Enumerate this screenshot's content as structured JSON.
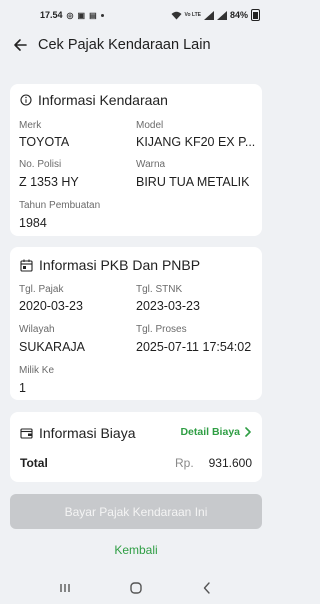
{
  "status_bar": {
    "time": "17.54",
    "battery": "84%",
    "network": "Vo LTE"
  },
  "header": {
    "title": "Cek Pajak Kendaraan Lain"
  },
  "vehicle_info": {
    "title": "Informasi Kendaraan",
    "fields": {
      "merk": {
        "label": "Merk",
        "value": "TOYOTA"
      },
      "model": {
        "label": "Model",
        "value": "KIJANG KF20 EX P..."
      },
      "no_polisi": {
        "label": "No. Polisi",
        "value": "Z 1353 HY"
      },
      "warna": {
        "label": "Warna",
        "value": "BIRU TUA METALIK"
      },
      "tahun": {
        "label": "Tahun Pembuatan",
        "value": "1984"
      }
    }
  },
  "pkb_info": {
    "title": "Informasi PKB Dan PNBP",
    "fields": {
      "tgl_pajak": {
        "label": "Tgl. Pajak",
        "value": "2020-03-23"
      },
      "tgl_stnk": {
        "label": "Tgl. STNK",
        "value": "2023-03-23"
      },
      "wilayah": {
        "label": "Wilayah",
        "value": "SUKARAJA"
      },
      "tgl_proses": {
        "label": "Tgl. Proses",
        "value": "2025-07-11 17:54:02"
      },
      "milik_ke": {
        "label": "Milik Ke",
        "value": "1"
      }
    }
  },
  "cost_info": {
    "title": "Informasi Biaya",
    "detail_label": "Detail Biaya",
    "total_label": "Total",
    "currency": "Rp.",
    "amount": "931.600"
  },
  "actions": {
    "pay_label": "Bayar Pajak Kendaraan Ini",
    "back_label": "Kembali"
  },
  "colors": {
    "accent": "#2f9e44",
    "background": "#eff1f4",
    "disabled_button": "#c7c9cc"
  }
}
